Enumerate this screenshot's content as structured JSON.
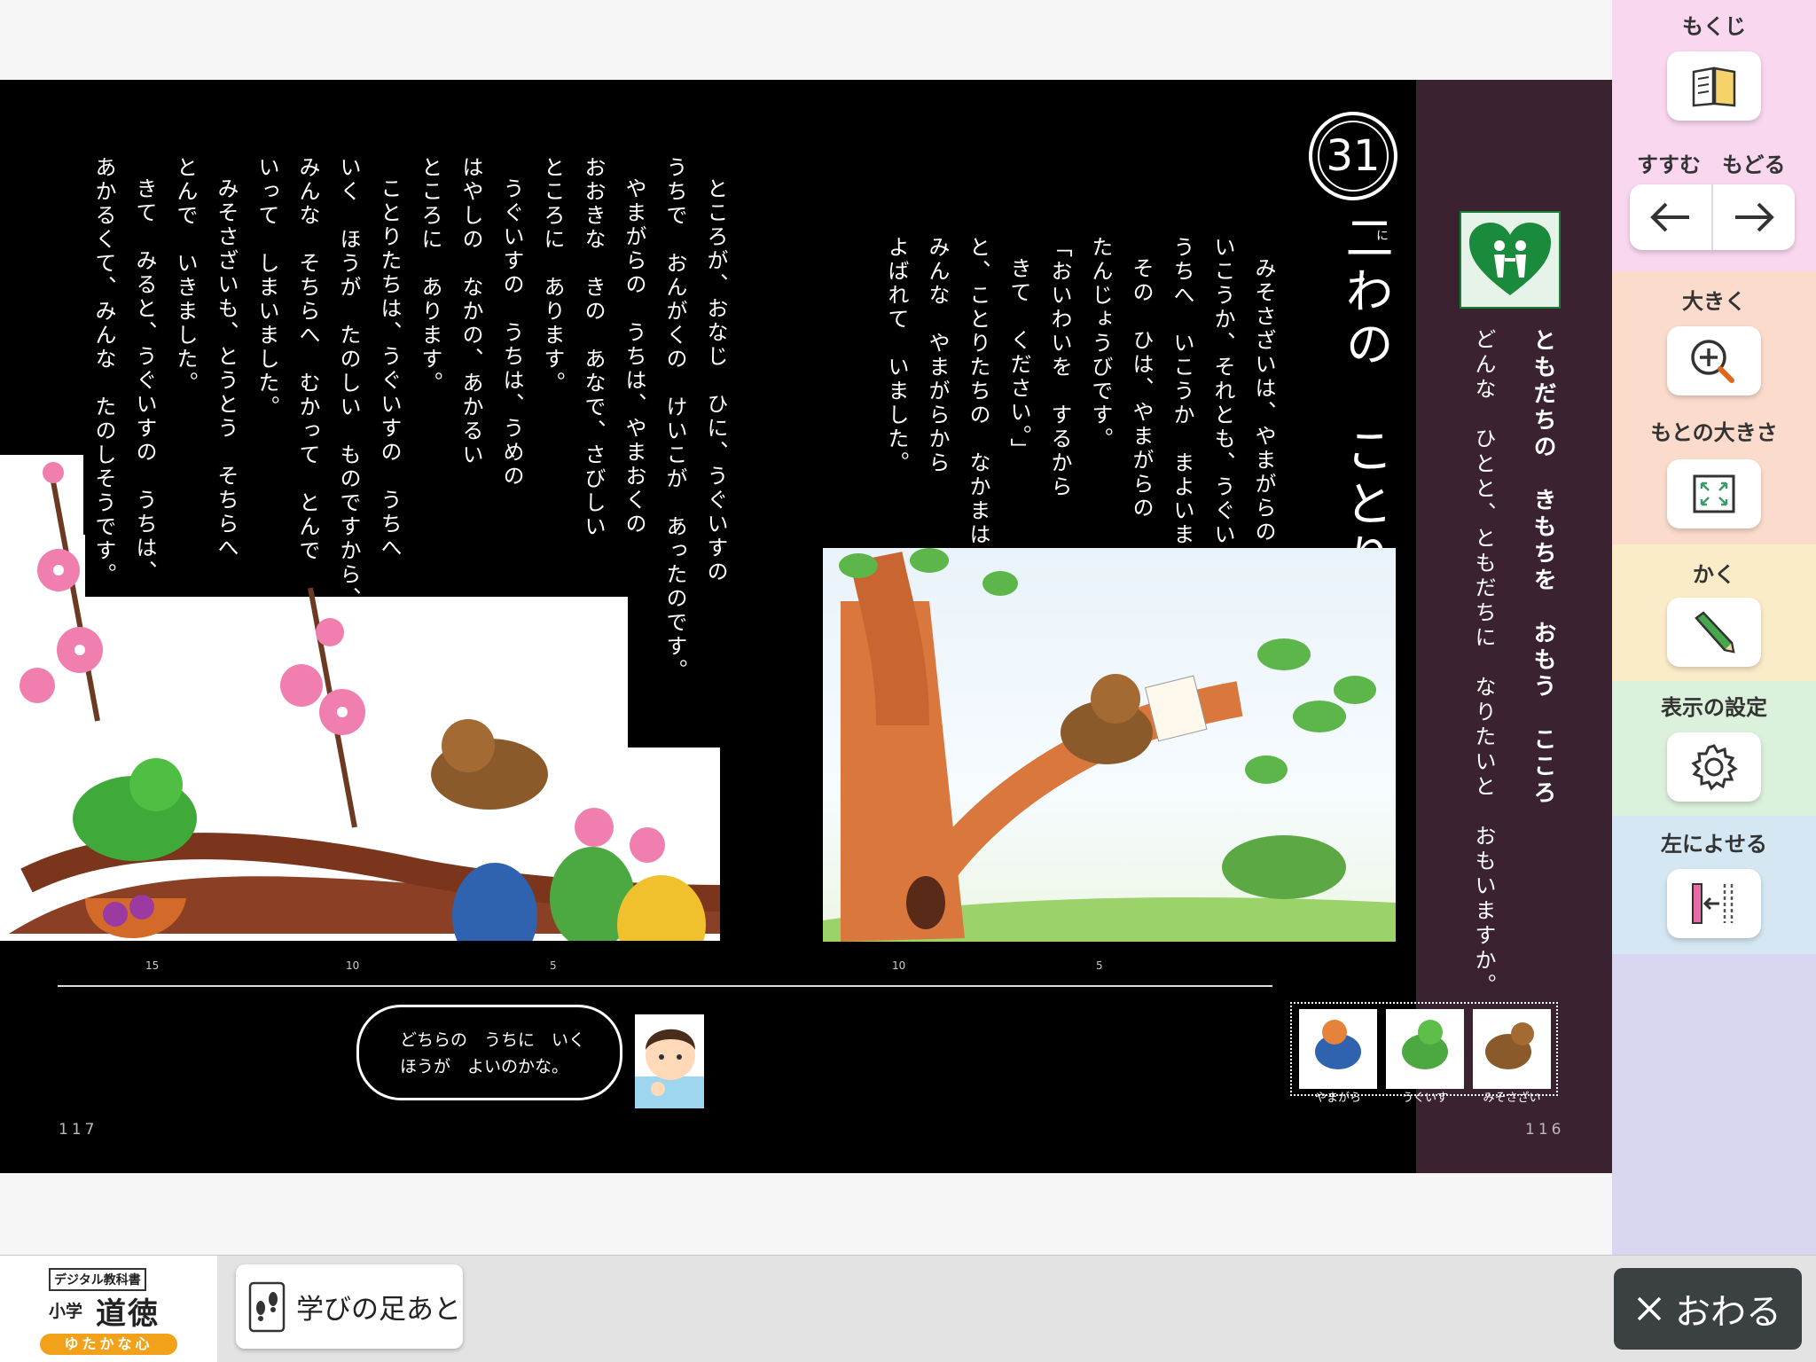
{
  "lesson": {
    "number": "31",
    "title": "二わの　ことり",
    "furigana": "に",
    "theme": "ともだちの　きもちを　おもう　こころ",
    "question": "どんな　ひとと、ともだちに　なりたいと　おもいますか。"
  },
  "right_page_text": [
    "みそさざいは、やまがらの　うちへ",
    "いこうか、それとも、うぐいすの",
    "うちへ　いこうか　まよいました。",
    "その　ひは、やまがらの",
    "たんじょうびです。",
    "「おいわいを　するから",
    "きて　ください。」",
    "と、ことりたちの　なかまは",
    "みんな　やまがらから",
    "よばれて　いました。"
  ],
  "left_page_text": [
    "ところが、おなじ　ひに、うぐいすの",
    "うちで　おんがくの　けいこが　あったのです。",
    "やまがらの　うちは、やまおくの",
    "おおきな　きの　あなで、さびしい",
    "ところに　あります。",
    "うぐいすの　うちは、うめの",
    "はやしの　なかの、あかるい",
    "ところに　あります。",
    "ことりたちは、うぐいすの　うちへ",
    "いく　ほうが　たのしい　ものですから、",
    "みんな　そちらへ　むかって　とんで",
    "いって　しまいました。",
    "みそさざいも、とうとう　そちらへ",
    "とんで　いきました。",
    "きて　みると、うぐいすの　うちは、",
    "あかるくて、みんな　たのしそうです。"
  ],
  "line_numbers_left": [
    "15",
    "10",
    "5"
  ],
  "line_numbers_right": [
    "10",
    "5"
  ],
  "speech_bubble": {
    "line1": "どちらの　うちに　いく",
    "line2": "ほうが　よいのかな。"
  },
  "characters": [
    {
      "name": "やまがら",
      "icon": "yamagara-bird-icon"
    },
    {
      "name": "うぐいす",
      "icon": "uguisu-bird-icon"
    },
    {
      "name": "みそさざい",
      "icon": "misosazai-bird-icon"
    }
  ],
  "page_numbers": {
    "left": "117",
    "right": "116"
  },
  "toolbar": {
    "toc_label": "もくじ",
    "forward_label": "すすむ",
    "back_label": "もどる",
    "zoom_in_label": "大きく",
    "original_size_label": "もとの大きさ",
    "draw_label": "かく",
    "display_settings_label": "表示の設定",
    "align_left_label": "左によせる",
    "colors": {
      "pink": "#f9d7ef",
      "peach": "#fbdccc",
      "yellow": "#fbecc9",
      "green": "#dcf1dc",
      "blue": "#d5e7f2",
      "lavender": "#d8d6f1"
    }
  },
  "bottom_bar": {
    "logo_tag": "デジタル教科書",
    "logo_small": "小学",
    "logo_big": "道徳",
    "logo_sub": "ゆたかな心",
    "footprints_label": "学びの足あと",
    "close_label": "おわる"
  }
}
